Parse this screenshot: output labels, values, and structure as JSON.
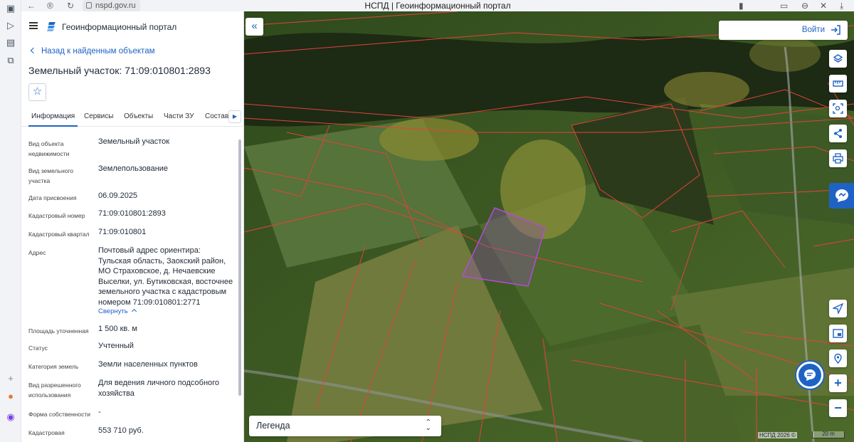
{
  "browser": {
    "url": "nspd.gov.ru",
    "tab_title": "НСПД | Геоинформационный портал"
  },
  "header": {
    "portal_name": "Геоинформационный портал"
  },
  "panel": {
    "back_link": "Назад к найденным объектам",
    "title": "Земельный участок: 71:09:010801:2893",
    "tabs": [
      "Информация",
      "Сервисы",
      "Объекты",
      "Части ЗУ",
      "Состав"
    ],
    "active_tab": "Информация",
    "properties": [
      {
        "label": "Вид объекта недвижимости",
        "value": "Земельный участок"
      },
      {
        "label": "Вид земельного участка",
        "value": "Землепользование"
      },
      {
        "label": "Дата присвоения",
        "value": "06.09.2025"
      },
      {
        "label": "Кадастровый номер",
        "value": "71:09:010801:2893"
      },
      {
        "label": "Кадастровый квартал",
        "value": "71:09:010801"
      },
      {
        "label": "Адрес",
        "value": "Почтовый адрес ориентира: Тульская область, Заокский район, МО Страховское, д. Нечаевские Выселки, ул. Бутиковская, восточнее земельного участка с кадастровым номером 71:09:010801:2771"
      },
      {
        "label": "Площадь уточненная",
        "value": "1 500 кв. м"
      },
      {
        "label": "Статус",
        "value": "Учтенный"
      },
      {
        "label": "Категория земель",
        "value": "Земли населенных пунктов"
      },
      {
        "label": "Вид разрешенного использования",
        "value": "Для ведения личного подсобного хозяйства"
      },
      {
        "label": "Форма собственности",
        "value": "-"
      },
      {
        "label": "Кадастровая",
        "value": "553 710 руб."
      }
    ],
    "collapse_label": "Свернуть"
  },
  "map": {
    "login_label": "Войти",
    "legend_label": "Легенда",
    "copyright": "НСПД 2026 ©",
    "scale_label": "20 m",
    "colors": {
      "accent": "#1e63c4",
      "parcel_border": "#e0443a",
      "selected_parcel": "#b44bd6"
    }
  }
}
